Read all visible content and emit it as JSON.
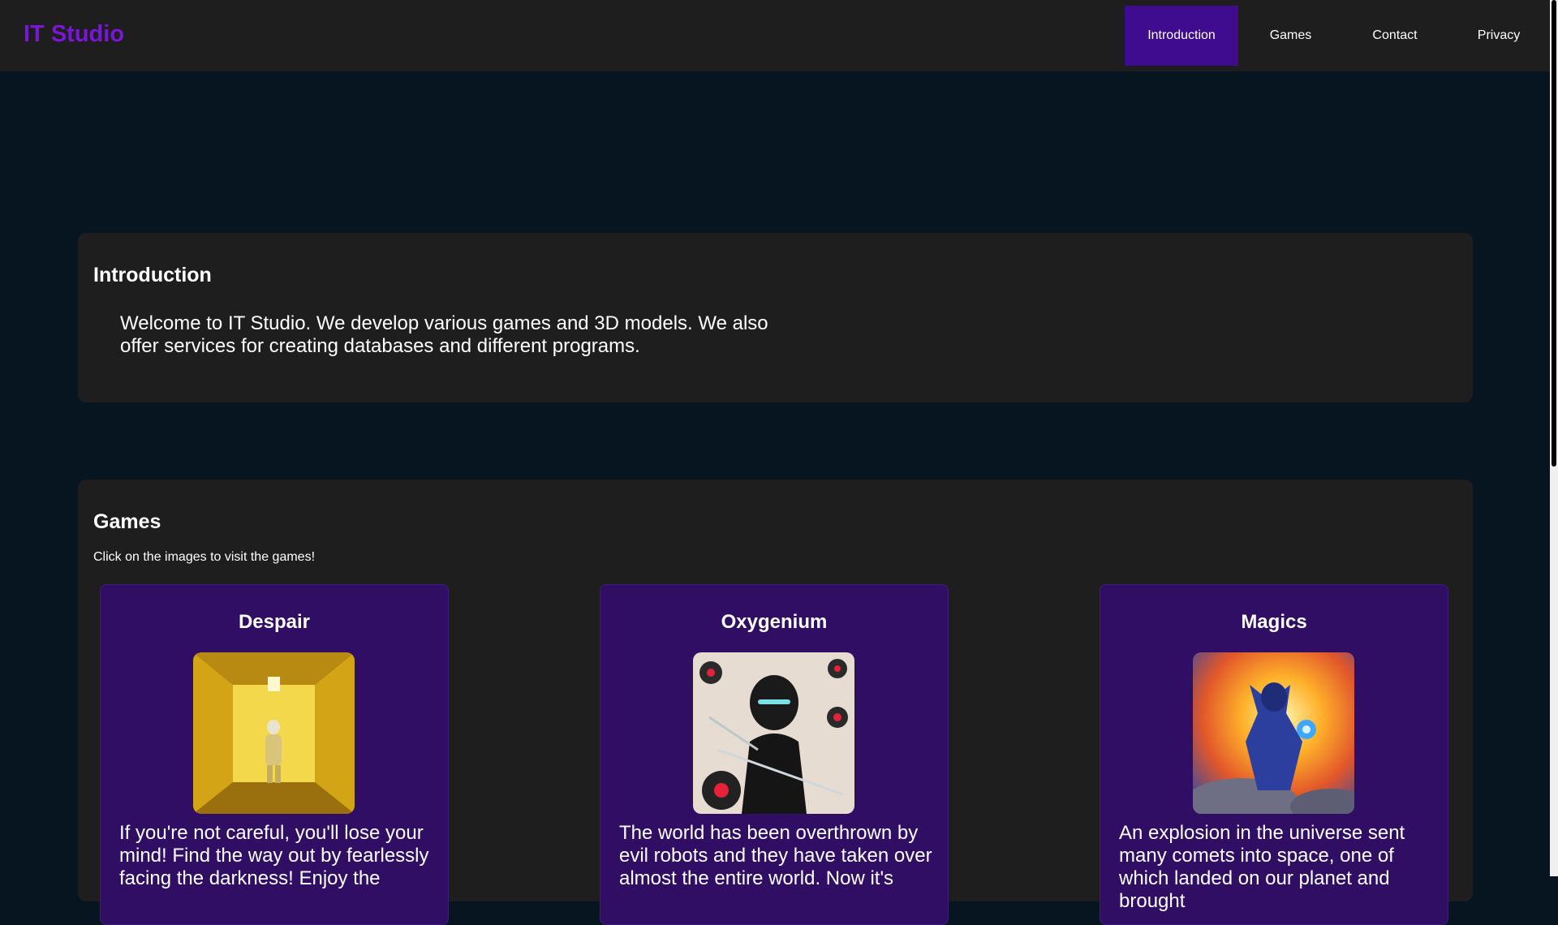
{
  "header": {
    "brand": "IT Studio",
    "nav": [
      {
        "label": "Introduction",
        "active": true
      },
      {
        "label": "Games",
        "active": false
      },
      {
        "label": "Contact",
        "active": false
      },
      {
        "label": "Privacy",
        "active": false
      }
    ]
  },
  "intro": {
    "title": "Introduction",
    "text": "Welcome to IT Studio. We develop various games and 3D models. We also offer services for creating databases and different programs."
  },
  "games": {
    "title": "Games",
    "hint": "Click on the images to visit the games!",
    "cards": [
      {
        "title": "Despair",
        "image_icon": "yellow-corridor-figure-image",
        "text": "If you're not careful, you'll lose your mind! Find the way out by fearlessly facing the darkness! Enjoy the"
      },
      {
        "title": "Oxygenium",
        "image_icon": "black-ninja-robot-image",
        "text": "The world has been overthrown by evil robots and they have taken over almost the entire world. Now it's"
      },
      {
        "title": "Magics",
        "image_icon": "armored-mage-explosion-image",
        "text": "An explosion in the universe sent many comets into space, one of which landed on our planet and brought"
      }
    ]
  },
  "colors": {
    "page_bg": "#061520",
    "panel_bg": "#1e1e1e",
    "brand": "#7b16d6",
    "nav_active": "#3f0b8f",
    "card_bg": "#2f0e63"
  }
}
